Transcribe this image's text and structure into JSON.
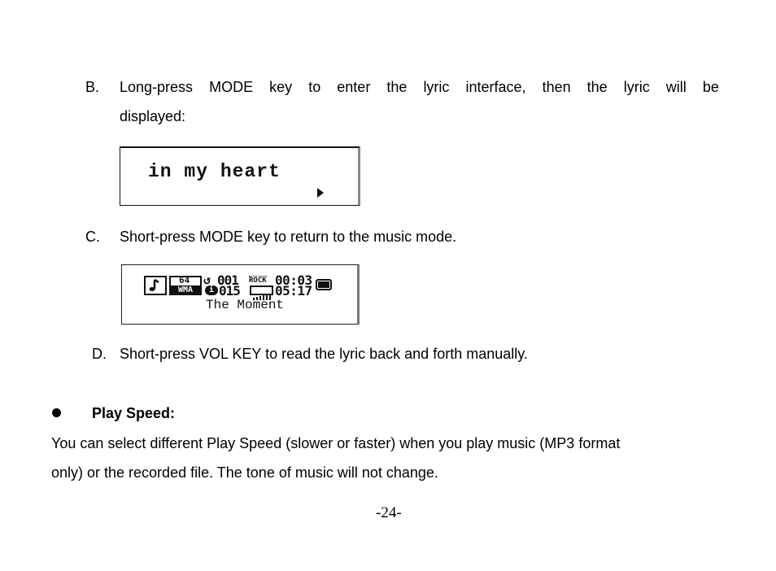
{
  "items": {
    "b": {
      "marker": "B.",
      "line1_words": [
        "Long-press",
        "MODE",
        "key",
        "to",
        "enter",
        "the",
        "lyric",
        "interface,",
        "then",
        "the",
        "lyric",
        "will",
        "be"
      ],
      "line2": "displayed:"
    },
    "c": {
      "marker": "C.",
      "text": "Short-press MODE key to return to the music mode."
    },
    "d": {
      "marker": "D.",
      "text": "Short-press VOL KEY to read the lyric back and forth manually."
    }
  },
  "lyric_screen": {
    "lyric": "in my heart",
    "icon": "play-arrow-icon"
  },
  "music_screen": {
    "file_icon": "music-note-icon",
    "bitrate": "64",
    "format": "WMA",
    "repeat_icon": "repeat-icon",
    "info_icon": "info-icon",
    "track_number": "001",
    "total_tracks": "015",
    "eq_mode": "ROCK",
    "eq_bars_icon": "equalizer-bars-icon",
    "elapsed_time": "00:03",
    "total_time": "05:17",
    "battery_icon": "battery-icon",
    "title": "The Moment"
  },
  "section": {
    "bullet_icon": "bullet-icon",
    "heading": "Play Speed:",
    "body_line1": "You can select different Play Speed (slower or faster) when you play music (MP3 format",
    "body_line2": "only) or the recorded file. The tone of music will not change."
  },
  "footer": {
    "page_number": "-24-"
  }
}
